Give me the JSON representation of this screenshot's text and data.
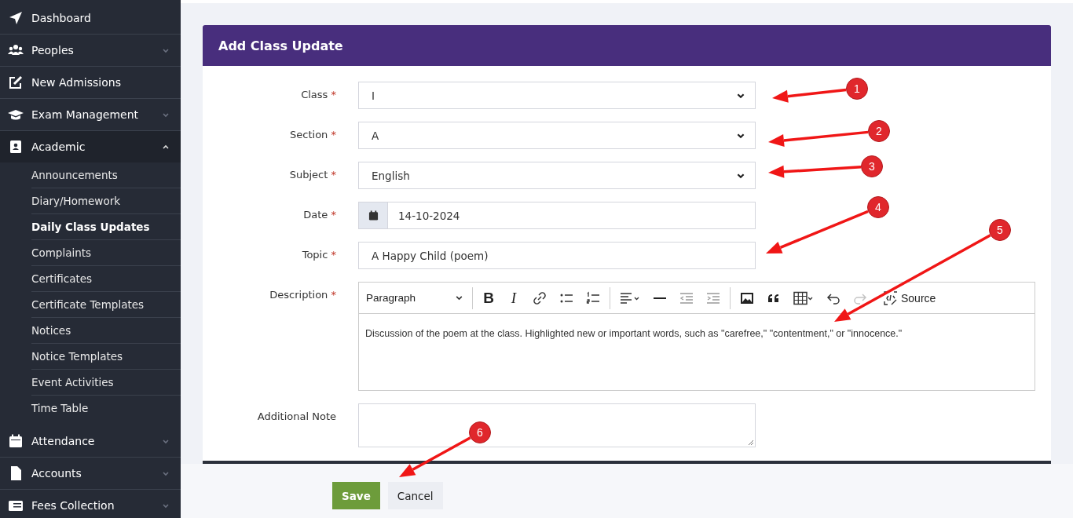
{
  "sidebar": {
    "items": [
      {
        "label": "Dashboard",
        "has_children": false,
        "expanded": false
      },
      {
        "label": "Peoples",
        "has_children": true,
        "expanded": false
      },
      {
        "label": "New Admissions",
        "has_children": false,
        "expanded": false
      },
      {
        "label": "Exam Management",
        "has_children": true,
        "expanded": false
      },
      {
        "label": "Academic",
        "has_children": true,
        "expanded": true,
        "children": [
          {
            "label": "Announcements",
            "selected": false
          },
          {
            "label": "Diary/Homework",
            "selected": false
          },
          {
            "label": "Daily Class Updates",
            "selected": true
          },
          {
            "label": "Complaints",
            "selected": false
          },
          {
            "label": "Certificates",
            "selected": false
          },
          {
            "label": "Certificate Templates",
            "selected": false
          },
          {
            "label": "Notices",
            "selected": false
          },
          {
            "label": "Notice Templates",
            "selected": false
          },
          {
            "label": "Event Activities",
            "selected": false
          },
          {
            "label": "Time Table",
            "selected": false
          }
        ]
      },
      {
        "label": "Attendance",
        "has_children": true,
        "expanded": false
      },
      {
        "label": "Accounts",
        "has_children": true,
        "expanded": false
      },
      {
        "label": "Fees Collection",
        "has_children": true,
        "expanded": false
      }
    ]
  },
  "card": {
    "title": "Add Class Update",
    "fields": [
      {
        "label": "Class",
        "required": true,
        "kind": "select",
        "value": "I"
      },
      {
        "label": "Section",
        "required": true,
        "kind": "select",
        "value": "A"
      },
      {
        "label": "Subject",
        "required": true,
        "kind": "select",
        "value": "English"
      },
      {
        "label": "Date",
        "required": true,
        "kind": "date",
        "value": "14-10-2024"
      },
      {
        "label": "Topic",
        "required": true,
        "kind": "text",
        "value": "A Happy Child (poem)"
      },
      {
        "label": "Description",
        "required": true,
        "kind": "editor",
        "value": "Discussion of the poem at the class. Highlighted new or important words, such as \"carefree,\" \"contentment,\" or \"innocence.\""
      },
      {
        "label": "Additional Note",
        "required": false,
        "kind": "textarea"
      }
    ],
    "required_mark": "*",
    "editor": {
      "format": "Paragraph",
      "bold": "B",
      "italic": "I",
      "source": "Source",
      "redo_disabled": true
    }
  },
  "buttons": [
    {
      "label": "Save",
      "kind": "primary"
    },
    {
      "label": "Cancel",
      "kind": "secondary"
    }
  ],
  "callouts": [
    "1",
    "2",
    "3",
    "4",
    "5",
    "6"
  ]
}
